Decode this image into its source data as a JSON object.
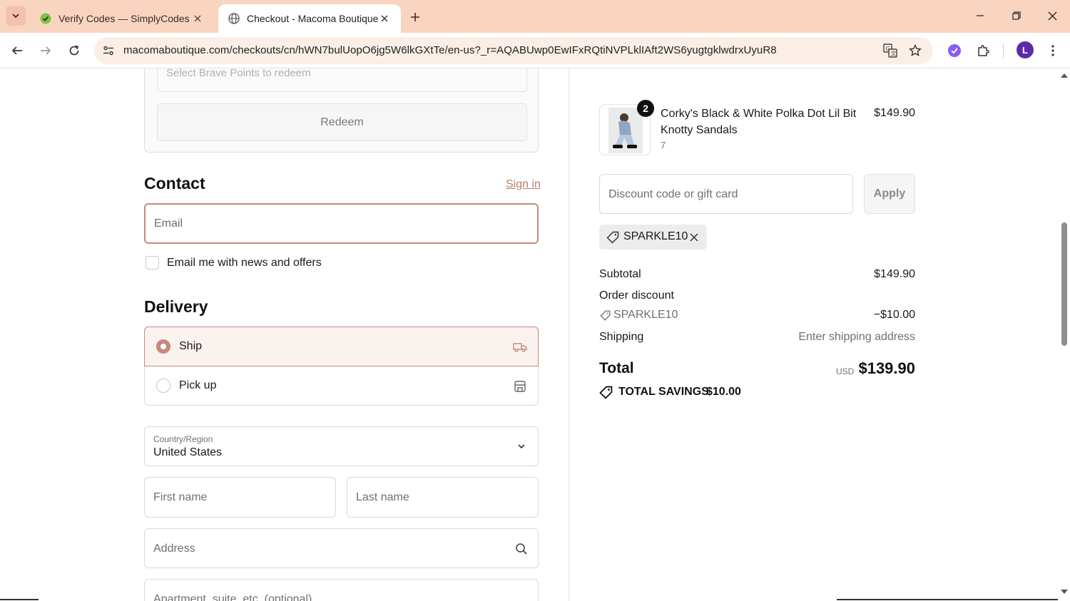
{
  "browser": {
    "tabs": [
      {
        "title": "Verify Codes — SimplyCodes",
        "active": false,
        "icon": "simplycodes-icon"
      },
      {
        "title": "Checkout - Macoma Boutique",
        "active": true,
        "icon": "globe-icon"
      }
    ],
    "url": "macomaboutique.com/checkouts/cn/hWN7bulUopO6jg5W6lkGXtTe/en-us?_r=AQABUwp0EwIFxRQtiNVPLklIAft2WS6yugtgklwdrxUyuR8",
    "profile_initial": "L",
    "colors": {
      "tabbar": "#f9d5c1",
      "omnibox": "#fbeee7",
      "profile": "#5c2ca8"
    }
  },
  "redeem": {
    "select_placeholder": "Select Brave Points to redeem",
    "button_label": "Redeem"
  },
  "contact": {
    "heading": "Contact",
    "sign_in": "Sign in",
    "email_placeholder": "Email",
    "newsletter_label": "Email me with news and offers",
    "newsletter_checked": false
  },
  "delivery": {
    "heading": "Delivery",
    "options": [
      {
        "label": "Ship",
        "selected": true,
        "icon": "truck-icon"
      },
      {
        "label": "Pick up",
        "selected": false,
        "icon": "store-icon"
      }
    ],
    "country_label": "Country/Region",
    "country_value": "United States",
    "first_name_placeholder": "First name",
    "last_name_placeholder": "Last name",
    "address_placeholder": "Address",
    "apartment_placeholder": "Apartment, suite, etc. (optional)"
  },
  "summary": {
    "product": {
      "name": "Corky's Black & White Polka Dot Lil Bit Knotty Sandals",
      "variant": "7",
      "quantity": "2",
      "price": "$149.90"
    },
    "discount_placeholder": "Discount code or gift card",
    "apply_label": "Apply",
    "applied_code": "SPARKLE10",
    "subtotal_label": "Subtotal",
    "subtotal_value": "$149.90",
    "order_discount_label": "Order discount",
    "discount_code": "SPARKLE10",
    "discount_value": "−$10.00",
    "shipping_label": "Shipping",
    "shipping_value": "Enter shipping address",
    "total_label": "Total",
    "total_currency": "USD",
    "total_value": "$139.90",
    "savings_label": "TOTAL SAVINGS",
    "savings_value": "$10.00"
  },
  "accent_color": "#c48a7c"
}
